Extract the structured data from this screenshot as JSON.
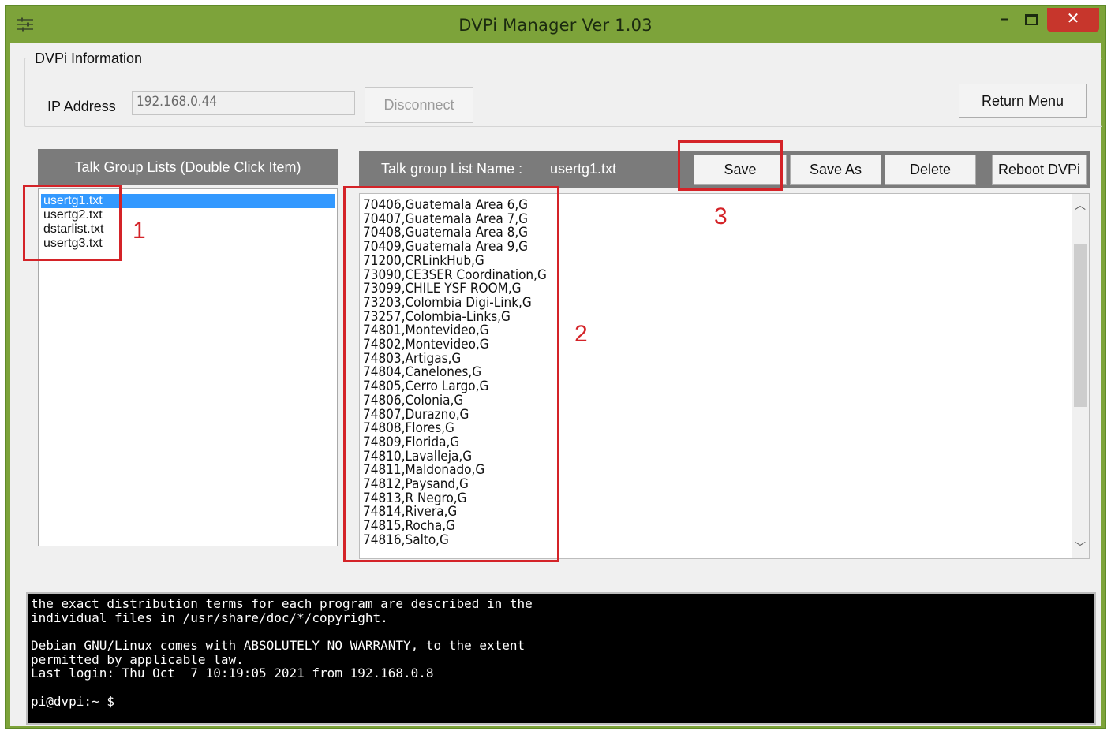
{
  "window": {
    "title": "DVPi Manager Ver 1.03",
    "controls": [
      "minimize",
      "maximize",
      "close"
    ]
  },
  "info": {
    "group_label": "DVPi Information",
    "ip_label": "IP Address",
    "ip_value": "192.168.0.44",
    "disconnect_label": "Disconnect",
    "return_label": "Return Menu"
  },
  "talk_group_lists": {
    "header": "Talk Group Lists (Double Click Item)",
    "items": [
      "usertg1.txt",
      "usertg2.txt",
      "dstarlist.txt",
      "usertg3.txt"
    ],
    "selected_index": 0
  },
  "editor": {
    "list_name_label": "Talk group List Name :",
    "list_name": "usertg1.txt",
    "buttons": {
      "save": "Save",
      "save_as": "Save As",
      "delete": "Delete",
      "reboot": "Reboot DVPi"
    },
    "lines": [
      "70406,Guatemala Area 6,G",
      "70407,Guatemala Area 7,G",
      "70408,Guatemala Area 8,G",
      "70409,Guatemala Area 9,G",
      "71200,CRLinkHub,G",
      "73090,CE3SER Coordination,G",
      "73099,CHILE YSF ROOM,G",
      "73203,Colombia Digi-Link,G",
      "73257,Colombia-Links,G",
      "74801,Montevideo,G",
      "74802,Montevideo,G",
      "74803,Artigas,G",
      "74804,Canelones,G",
      "74805,Cerro Largo,G",
      "74806,Colonia,G",
      "74807,Durazno,G",
      "74808,Flores,G",
      "74809,Florida,G",
      "74810,Lavalleja,G",
      "74811,Maldonado,G",
      "74812,Paysand,G",
      "74813,R Negro,G",
      "74814,Rivera,G",
      "74815,Rocha,G",
      "74816,Salto,G"
    ]
  },
  "terminal": {
    "lines": [
      "the exact distribution terms for each program are described in the",
      "individual files in /usr/share/doc/*/copyright.",
      "",
      "Debian GNU/Linux comes with ABSOLUTELY NO WARRANTY, to the extent",
      "permitted by applicable law.",
      "Last login: Thu Oct  7 10:19:05 2021 from 192.168.0.8",
      "",
      "pi@dvpi:~ $"
    ]
  },
  "annotations": {
    "one": "1",
    "two": "2",
    "three": "3",
    "color": "#d42328"
  }
}
